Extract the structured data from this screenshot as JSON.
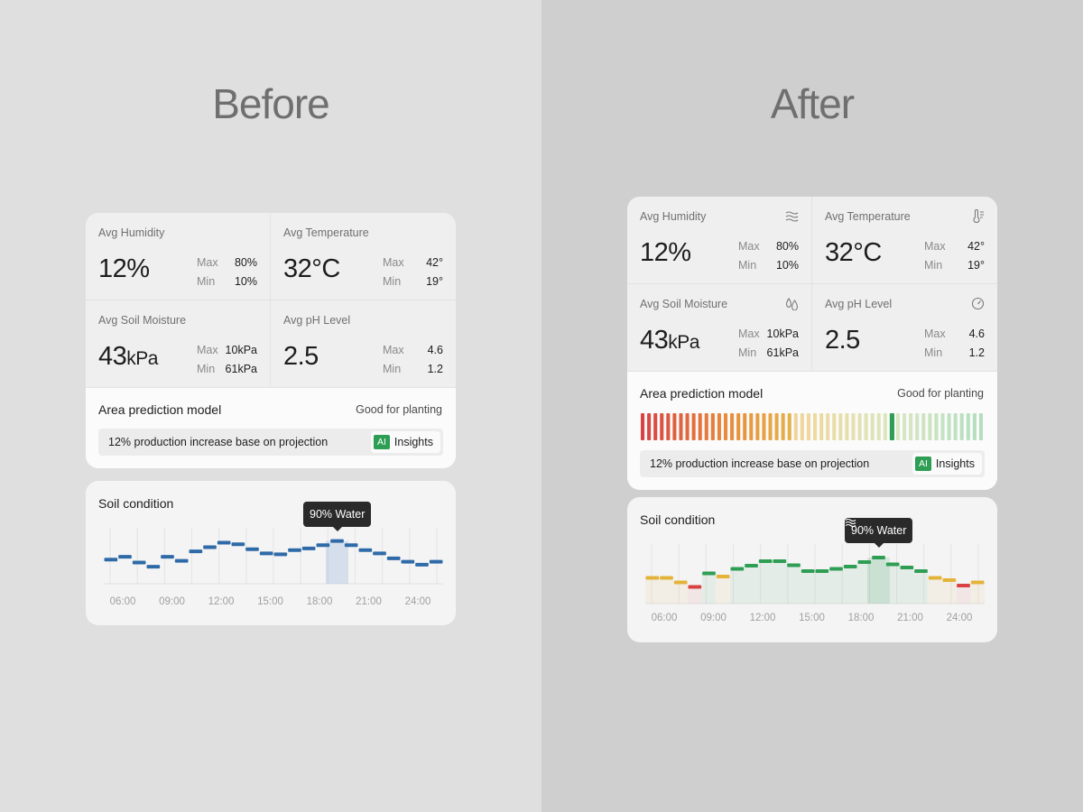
{
  "before": {
    "title": "Before",
    "metrics": [
      {
        "label": "Avg Humidity",
        "value": "12%",
        "unit": "",
        "max_label": "Max",
        "max": "80%",
        "min_label": "Min",
        "min": "10%"
      },
      {
        "label": "Avg Temperature",
        "value": "32°C",
        "unit": "",
        "max_label": "Max",
        "max": "42°",
        "min_label": "Min",
        "min": "19°"
      },
      {
        "label": "Avg Soil Moisture",
        "value": "43",
        "unit": "kPa",
        "max_label": "Max",
        "max": "10kPa",
        "min_label": "Min",
        "min": "61kPa"
      },
      {
        "label": "Avg pH Level",
        "value": "2.5",
        "unit": "",
        "max_label": "Max",
        "max": "4.6",
        "min_label": "Min",
        "min": "1.2"
      }
    ],
    "prediction": {
      "title": "Area prediction model",
      "status": "Good for planting",
      "insight_text": "12% production increase base on projection",
      "ai_badge": "AI",
      "insight_button": "Insights"
    },
    "soil": {
      "title": "Soil condition",
      "tooltip": "90% Water",
      "x_ticks": [
        "06:00",
        "09:00",
        "12:00",
        "15:00",
        "18:00",
        "21:00",
        "24:00"
      ]
    }
  },
  "after": {
    "title": "After",
    "metrics": [
      {
        "label": "Avg Humidity",
        "value": "12%",
        "unit": "",
        "max_label": "Max",
        "max": "80%",
        "min_label": "Min",
        "min": "10%",
        "icon": "humidity-waves-icon"
      },
      {
        "label": "Avg Temperature",
        "value": "32°C",
        "unit": "",
        "max_label": "Max",
        "max": "42°",
        "min_label": "Min",
        "min": "19°",
        "icon": "thermometer-icon"
      },
      {
        "label": "Avg Soil Moisture",
        "value": "43",
        "unit": "kPa",
        "max_label": "Max",
        "max": "10kPa",
        "min_label": "Min",
        "min": "61kPa",
        "icon": "water-drops-icon"
      },
      {
        "label": "Avg pH Level",
        "value": "2.5",
        "unit": "",
        "max_label": "Max",
        "max": "4.6",
        "min_label": "Min",
        "min": "1.2",
        "icon": "gauge-icon"
      }
    ],
    "prediction": {
      "title": "Area prediction model",
      "status": "Good for planting",
      "insight_text": "12% production increase base on projection",
      "ai_badge": "AI",
      "insight_button": "Insights",
      "indicator_position": 0.74
    },
    "soil": {
      "title": "Soil condition",
      "tooltip": "90% Water",
      "tooltip_icon": "water-waves-icon",
      "x_ticks": [
        "06:00",
        "09:00",
        "12:00",
        "15:00",
        "18:00",
        "21:00",
        "24:00"
      ]
    }
  },
  "colors": {
    "before_series": "#2f6aa8",
    "good": "#2e9e54",
    "medium": "#e4b33a",
    "bad": "#d94242",
    "ai_badge": "#2e9e54"
  },
  "chart_data": [
    {
      "type": "line",
      "title": "Soil condition",
      "x_ticks": [
        "06:00",
        "09:00",
        "12:00",
        "15:00",
        "18:00",
        "21:00",
        "24:00"
      ],
      "series": [
        {
          "values": [
            45,
            52,
            38,
            28,
            52,
            42,
            65,
            75,
            86,
            82,
            70,
            60,
            58,
            68,
            72,
            80,
            90,
            80,
            68,
            60,
            48,
            40,
            33,
            40
          ]
        }
      ],
      "highlight": {
        "label": "90% Water",
        "index": 16
      }
    },
    {
      "type": "line",
      "title": "Soil condition",
      "x_ticks": [
        "06:00",
        "09:00",
        "12:00",
        "15:00",
        "18:00",
        "21:00",
        "24:00"
      ],
      "series": [
        {
          "values": [
            45,
            45,
            35,
            25,
            55,
            48,
            65,
            72,
            82,
            82,
            73,
            60,
            60,
            65,
            70,
            80,
            90,
            75,
            68,
            60,
            45,
            40,
            28,
            35
          ]
        }
      ],
      "highlight": {
        "label": "90% Water",
        "index": 16
      }
    }
  ]
}
